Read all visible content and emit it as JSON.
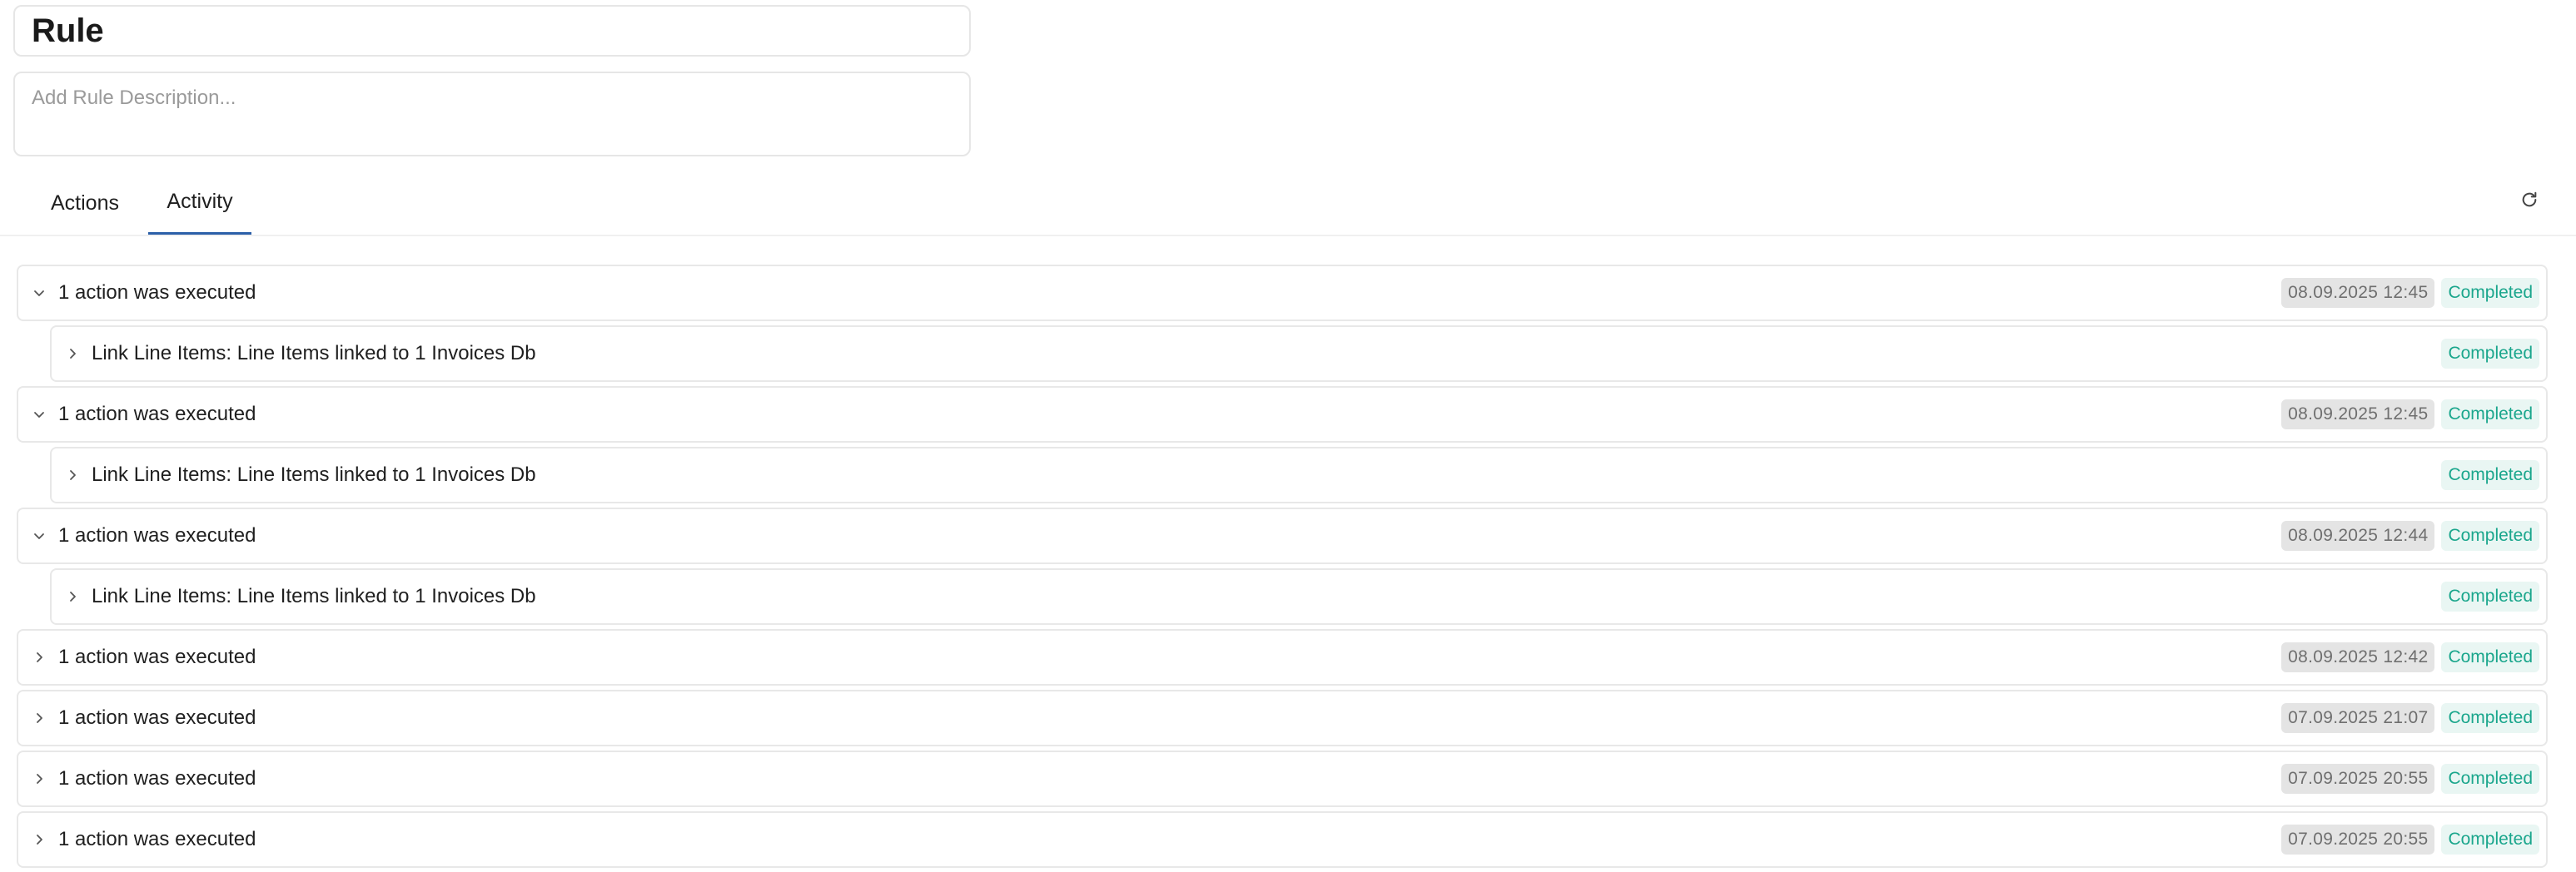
{
  "rule": {
    "title": "Rule",
    "description_value": "",
    "description_placeholder": "Add Rule Description..."
  },
  "tabs": [
    {
      "label": "Actions",
      "active": false
    },
    {
      "label": "Activity",
      "active": true
    }
  ],
  "icons": {
    "refresh": "refresh-icon",
    "expanded": "chevron-down-icon",
    "collapsed": "chevron-right-icon"
  },
  "colors": {
    "tab_active_underline": "#2b5fa8",
    "status_text": "#1aa68c",
    "status_bg": "#e9f6f3",
    "timestamp_bg": "#e4e4e4",
    "timestamp_text": "#6f6f6f"
  },
  "activity": [
    {
      "label": "1 action was executed",
      "timestamp": "08.09.2025 12:45",
      "status": "Completed",
      "expanded": true,
      "children": [
        {
          "label": "Link Line Items: Line Items linked to 1 Invoices Db",
          "status": "Completed"
        }
      ]
    },
    {
      "label": "1 action was executed",
      "timestamp": "08.09.2025 12:45",
      "status": "Completed",
      "expanded": true,
      "children": [
        {
          "label": "Link Line Items: Line Items linked to 1 Invoices Db",
          "status": "Completed"
        }
      ]
    },
    {
      "label": "1 action was executed",
      "timestamp": "08.09.2025 12:44",
      "status": "Completed",
      "expanded": true,
      "children": [
        {
          "label": "Link Line Items: Line Items linked to 1 Invoices Db",
          "status": "Completed"
        }
      ]
    },
    {
      "label": "1 action was executed",
      "timestamp": "08.09.2025 12:42",
      "status": "Completed",
      "expanded": false,
      "children": []
    },
    {
      "label": "1 action was executed",
      "timestamp": "07.09.2025 21:07",
      "status": "Completed",
      "expanded": false,
      "children": []
    },
    {
      "label": "1 action was executed",
      "timestamp": "07.09.2025 20:55",
      "status": "Completed",
      "expanded": false,
      "children": []
    },
    {
      "label": "1 action was executed",
      "timestamp": "07.09.2025 20:55",
      "status": "Completed",
      "expanded": false,
      "children": []
    }
  ]
}
